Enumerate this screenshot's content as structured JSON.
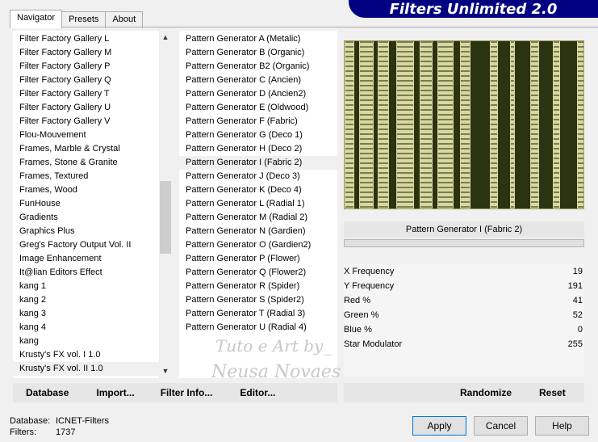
{
  "tabs": [
    "Navigator",
    "Presets",
    "About"
  ],
  "banner": "Filters Unlimited 2.0",
  "categories": [
    "Filter Factory Gallery L",
    "Filter Factory Gallery M",
    "Filter Factory Gallery P",
    "Filter Factory Gallery Q",
    "Filter Factory Gallery T",
    "Filter Factory Gallery U",
    "Filter Factory Gallery V",
    "Flou-Mouvement",
    "Frames, Marble & Crystal",
    "Frames, Stone & Granite",
    "Frames, Textured",
    "Frames, Wood",
    "FunHouse",
    "Gradients",
    "Graphics Plus",
    "Greg's Factory Output Vol. II",
    "Image Enhancement",
    "It@lian Editors Effect",
    "kang 1",
    "kang 2",
    "kang 3",
    "kang 4",
    "kang",
    "Krusty's FX vol. I 1.0",
    "Krusty's FX vol. II 1.0"
  ],
  "selected_category": "Krusty's FX vol. II 1.0",
  "filters": [
    "Pattern Generator A (Metalic)",
    "Pattern Generator B (Organic)",
    "Pattern Generator B2 (Organic)",
    "Pattern Generator C (Ancien)",
    "Pattern Generator D (Ancien2)",
    "Pattern Generator E (Oldwood)",
    "Pattern Generator F (Fabric)",
    "Pattern Generator G (Deco 1)",
    "Pattern Generator H (Deco 2)",
    "Pattern Generator I (Fabric 2)",
    "Pattern Generator J (Deco 3)",
    "Pattern Generator K (Deco 4)",
    "Pattern Generator L (Radial 1)",
    "Pattern Generator M (Radial 2)",
    "Pattern Generator N (Gardien)",
    "Pattern Generator O (Gardien2)",
    "Pattern Generator P (Flower)",
    "Pattern Generator Q (Flower2)",
    "Pattern Generator R (Spider)",
    "Pattern Generator S (Spider2)",
    "Pattern Generator T (Radial 3)",
    "Pattern Generator U (Radial 4)"
  ],
  "selected_filter": "Pattern Generator I (Fabric 2)",
  "params": [
    {
      "label": "X Frequency",
      "value": "19"
    },
    {
      "label": "Y Frequency",
      "value": "191"
    },
    {
      "label": "Red %",
      "value": "41"
    },
    {
      "label": "Green %",
      "value": "52"
    },
    {
      "label": "Blue %",
      "value": "0"
    },
    {
      "label": "Star Modulator",
      "value": "255"
    }
  ],
  "buttons": {
    "database": "Database",
    "import": "Import...",
    "filter_info": "Filter Info...",
    "editor": "Editor...",
    "randomize": "Randomize",
    "reset": "Reset",
    "apply": "Apply",
    "cancel": "Cancel",
    "help": "Help"
  },
  "status": {
    "database_label": "Database:",
    "database_value": "ICNET-Filters",
    "filters_label": "Filters:",
    "filters_value": "1737"
  },
  "watermark": {
    "line1": "Tuto e Art by_",
    "line2": "Neusa Novaes"
  },
  "colors": {
    "banner_bg": "#000080",
    "preview_light": "#d8d8a0",
    "preview_dark": "#2b3310"
  }
}
